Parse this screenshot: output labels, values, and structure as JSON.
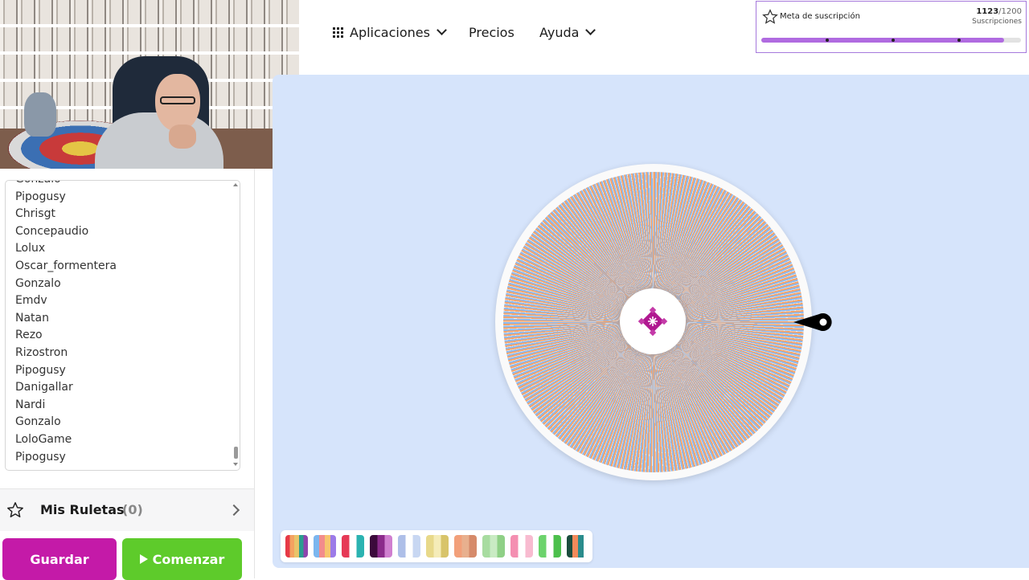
{
  "nav": {
    "apps_label": "Aplicaciones",
    "pricing_label": "Precios",
    "help_label": "Ayuda"
  },
  "goal": {
    "title": "Meta de suscripción",
    "current": "1123",
    "total": "/1200",
    "subtitle": "Suscripciones",
    "progress": 0.936,
    "accent": "#b06be0"
  },
  "entries": [
    "Gonzalo",
    "Pipogusy",
    "Chrisgt",
    "Concepaudio",
    "Lolux",
    "Oscar_formentera",
    "Gonzalo",
    "Emdv",
    "Natan",
    "Rezo",
    "Rizostron",
    "Pipogusy",
    "Danigallar",
    "Nardi",
    "Gonzalo",
    "LoloGame",
    "Pipogusy"
  ],
  "mis_ruletas": {
    "label": "Mis Ruletas",
    "count": "(0)"
  },
  "buttons": {
    "save_label": "Guardar",
    "start_label": "Comenzar"
  },
  "wheel": {
    "colors": [
      "#f4a36a",
      "#8cb9ee",
      "#f2f2f2"
    ],
    "logo_color": "#b01890"
  },
  "palettes": [
    [
      "#e63946",
      "#f4a261",
      "#e9c46a",
      "#2a9d8f",
      "#8e44ad"
    ],
    [
      "#7bb6ef",
      "#f28c8c",
      "#f6c56f",
      "#9c7be8"
    ],
    [
      "#e63956",
      "#ffffff",
      "#2bb3b1"
    ],
    [
      "#3c0a3c",
      "#8b2b8b",
      "#d07fd0"
    ],
    [
      "#aebfe8",
      "#ffffff",
      "#c8d7f2"
    ],
    [
      "#e8d98a",
      "#f5ecb8",
      "#d8c46a"
    ],
    [
      "#f2a07a",
      "#e8b08e",
      "#d68a6a"
    ],
    [
      "#a8dca0",
      "#c9ebc3",
      "#8fd086"
    ],
    [
      "#f48fb1",
      "#ffffff",
      "#f8bbd0"
    ],
    [
      "#6cd36c",
      "#ffffff",
      "#4cc04c"
    ],
    [
      "#1b4d3e",
      "#f28a5a",
      "#2a8c8c",
      "#ffffff"
    ]
  ]
}
